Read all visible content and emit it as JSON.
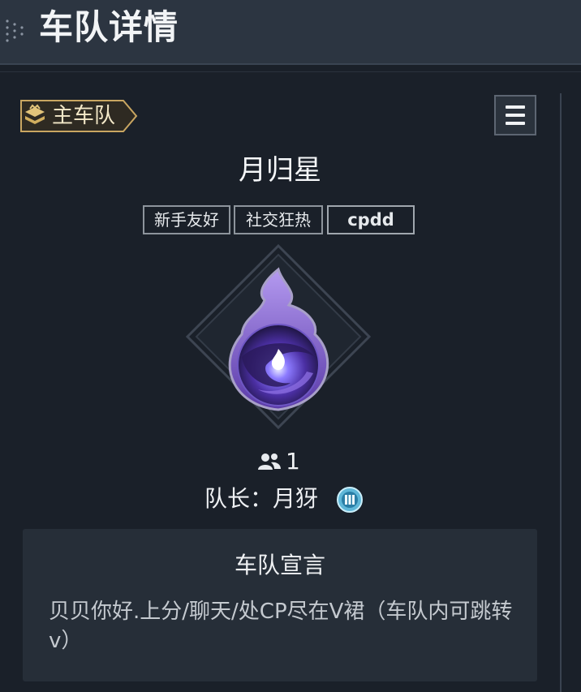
{
  "header": {
    "title": "车队详情",
    "dots_icon": "drag-dots-icon"
  },
  "badge": {
    "label": "主车队",
    "icon": "stack-layers-icon",
    "color": "#d6b46a"
  },
  "menu": {
    "icon": "hamburger-menu-icon"
  },
  "team": {
    "name": "月归星",
    "tags": [
      "新手友好",
      "社交狂热",
      "cpdd"
    ],
    "emblem_icon": "purple-flame-orb-emblem",
    "member_count": "1",
    "member_icon": "people-icon",
    "leader_label": "队长：月犽",
    "leader_level_icon": "level-III-badge-icon"
  },
  "manifesto": {
    "title": "车队宣言",
    "text": "贝贝你好.上分/聊天/处CP尽在V裙（车队内可跳转v）"
  },
  "colors": {
    "background": "#1a2029",
    "header": "#2c3541",
    "accent_gold": "#d6b46a",
    "emblem_purple": "#7b4fd6"
  }
}
